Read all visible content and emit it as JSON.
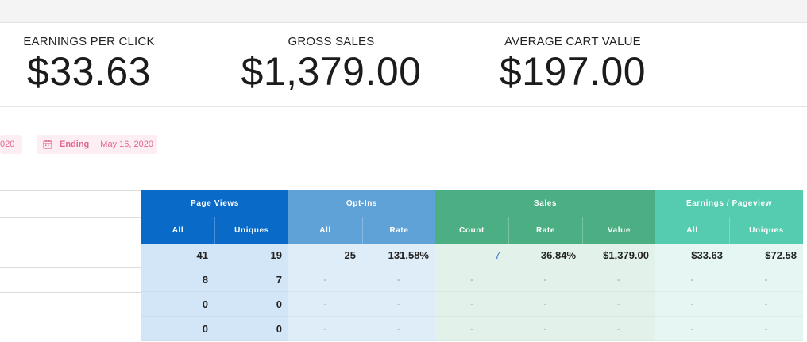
{
  "metrics": {
    "epc": {
      "label": "EARNINGS PER CLICK",
      "value": "$33.63"
    },
    "gross": {
      "label": "GROSS SALES",
      "value": "$1,379.00"
    },
    "cart": {
      "label": "AVERAGE CART VALUE",
      "value": "$197.00"
    }
  },
  "dates": {
    "start_partial": "020",
    "end_label": "Ending",
    "end_value": "May 16, 2020"
  },
  "colors": {
    "page_views": "#0a6ac8",
    "opt_ins": "#5fa2d8",
    "sales": "#4caf84",
    "earnings": "#55cbb0",
    "pv_body": "#d3e6f7",
    "opt_body": "#deedf8",
    "sales_body": "#e2f2ea",
    "earn_body": "#e6f6f2",
    "date_pill_text": "#e0678a"
  },
  "table": {
    "groups": [
      {
        "label": "Page Views"
      },
      {
        "label": "Opt-Ins"
      },
      {
        "label": "Sales"
      },
      {
        "label": "Earnings / Pageview"
      }
    ],
    "subheaders": [
      "All",
      "Uniques",
      "All",
      "Rate",
      "Count",
      "Rate",
      "Value",
      "All",
      "Uniques"
    ],
    "rows": [
      [
        "41",
        "19",
        "25",
        "131.58%",
        "7",
        "36.84%",
        "$1,379.00",
        "$33.63",
        "$72.58"
      ],
      [
        "8",
        "7",
        "-",
        "-",
        "-",
        "-",
        "-",
        "-",
        "-"
      ],
      [
        "0",
        "0",
        "-",
        "-",
        "-",
        "-",
        "-",
        "-",
        "-"
      ],
      [
        "0",
        "0",
        "-",
        "-",
        "-",
        "-",
        "-",
        "-",
        "-"
      ]
    ]
  }
}
